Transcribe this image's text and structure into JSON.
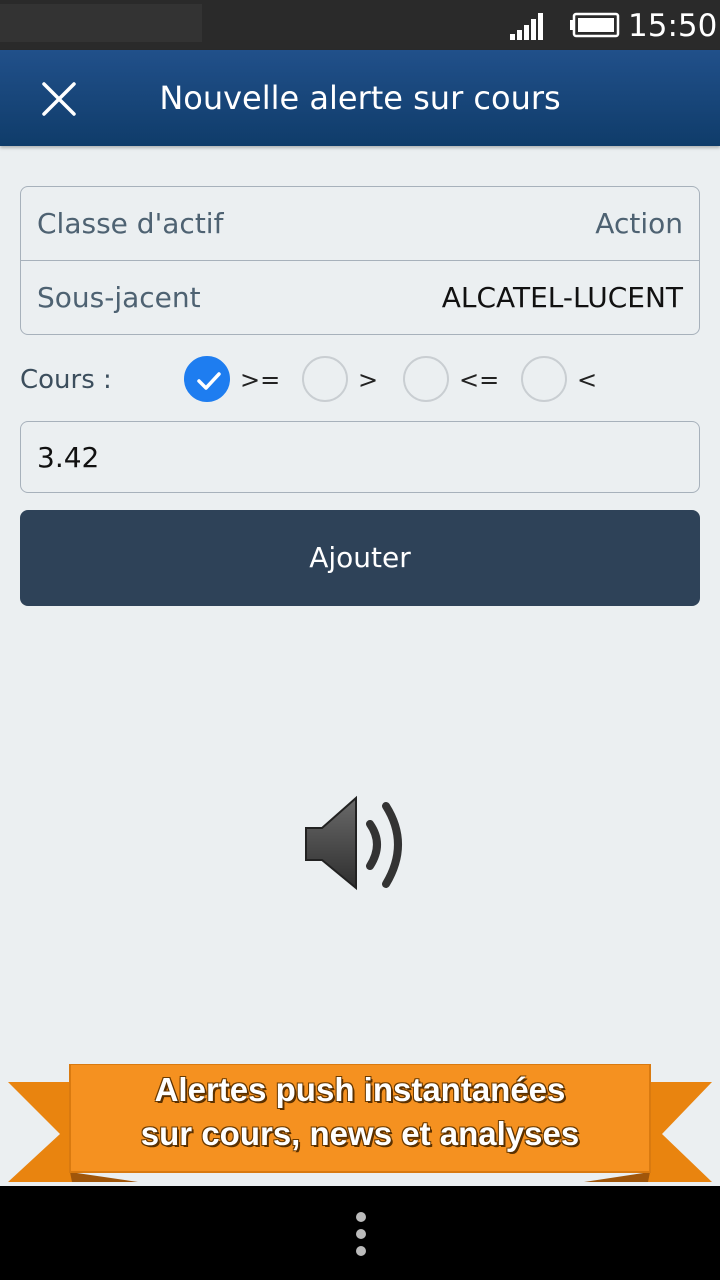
{
  "status_bar": {
    "time": "15:50",
    "icons": [
      "signal-icon",
      "battery-icon"
    ]
  },
  "app_bar": {
    "title": "Nouvelle alerte sur cours",
    "close_icon": "close-icon"
  },
  "info_card": {
    "rows": [
      {
        "label": "Classe d'actif",
        "value": "Action"
      },
      {
        "label": "Sous-jacent",
        "value": "ALCATEL-LUCENT"
      }
    ]
  },
  "cours": {
    "label": "Cours :",
    "options": [
      {
        "label": ">=",
        "checked": true
      },
      {
        "label": ">",
        "checked": false
      },
      {
        "label": "<=",
        "checked": false
      },
      {
        "label": "<",
        "checked": false
      }
    ]
  },
  "price_input": {
    "value": "3.42"
  },
  "add_button": {
    "label": "Ajouter"
  },
  "banner": {
    "line1": "Alertes push instantanées",
    "line2": "sur cours, news et analyses"
  },
  "colors": {
    "app_bar": "#1a4a80",
    "button": "#2e4258",
    "radio_checked": "#1e7df0",
    "banner": "#f59120"
  }
}
